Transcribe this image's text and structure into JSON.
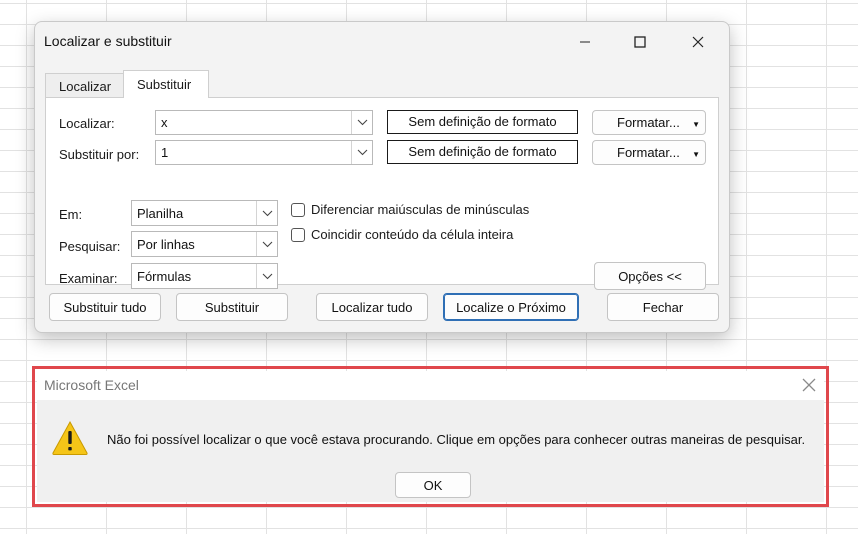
{
  "dialog": {
    "title": "Localizar e substituir",
    "tabs": [
      {
        "label": "Localizar",
        "selected": false
      },
      {
        "label": "Substituir",
        "selected": true
      }
    ],
    "find": {
      "label": "Localizar:",
      "value": "x",
      "format_label": "Sem definição de formato",
      "format_button": "Formatar..."
    },
    "replace": {
      "label": "Substituir por:",
      "value": "1",
      "format_label": "Sem definição de formato",
      "format_button": "Formatar..."
    },
    "within": {
      "label": "Em:",
      "value": "Planilha"
    },
    "search": {
      "label": "Pesquisar:",
      "value": "Por linhas"
    },
    "look_in": {
      "label": "Examinar:",
      "value": "Fórmulas"
    },
    "match_case": {
      "label": "Diferenciar maiúsculas de minúsculas",
      "checked": false
    },
    "match_entire": {
      "label": "Coincidir conteúdo da célula inteira",
      "checked": false
    },
    "options_button": "Opções <<",
    "buttons": {
      "replace_all": "Substituir tudo",
      "replace": "Substituir",
      "find_all": "Localizar tudo",
      "find_next": "Localize o Próximo",
      "close": "Fechar"
    }
  },
  "message_box": {
    "title": "Microsoft Excel",
    "text": "Não foi possível localizar o que você estava procurando. Clique em opções para conhecer outras maneiras de pesquisar.",
    "ok": "OK",
    "icon": "warning-icon",
    "highlight_color": "#e0474c"
  }
}
